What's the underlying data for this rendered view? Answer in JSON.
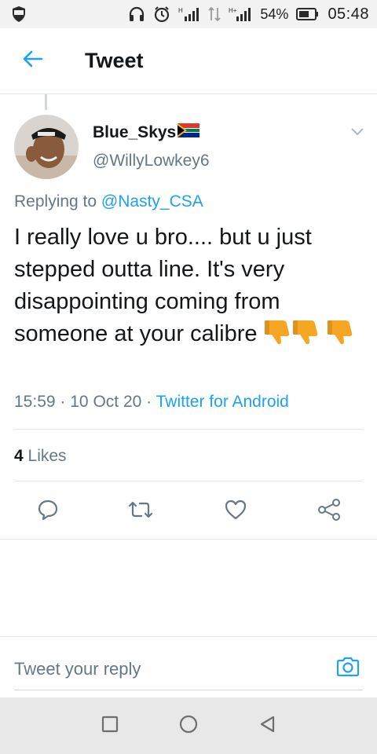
{
  "status_bar": {
    "battery_percent": "54%",
    "time": "05:48",
    "icons": [
      "shield-icon",
      "headphones-icon",
      "alarm-icon",
      "signal-icon",
      "data-arrows-icon",
      "signal-icon",
      "battery-icon"
    ]
  },
  "header": {
    "title": "Tweet",
    "back_icon": "arrow-left-icon"
  },
  "tweet": {
    "author_name": "Blue_Skys",
    "author_flag": "south-africa-flag",
    "author_handle": "@WillyLowkey6",
    "replying_prefix": "Replying to",
    "replying_to": "@Nasty_CSA",
    "text": "I really love u bro.... but u just stepped outta line. It's very disappointing coming from someone at your calibre",
    "text_emojis": [
      "thumbs-down",
      "thumbs-down",
      "thumbs-down"
    ],
    "time": "15:59",
    "separator": "·",
    "date": "10 Oct 20",
    "source": "Twitter for Android",
    "likes_count": "4",
    "likes_label": "Likes"
  },
  "actions": [
    "reply-icon",
    "retweet-icon",
    "like-icon",
    "share-icon"
  ],
  "reply": {
    "placeholder": "Tweet your reply"
  },
  "colors": {
    "accent": "#1da1f2",
    "secondary_text": "#657786",
    "primary_text": "#14171a",
    "divider": "#e1e8ed",
    "emoji": "#f5a623"
  },
  "nav_bar": [
    "square-icon",
    "circle-icon",
    "triangle-back-icon"
  ]
}
